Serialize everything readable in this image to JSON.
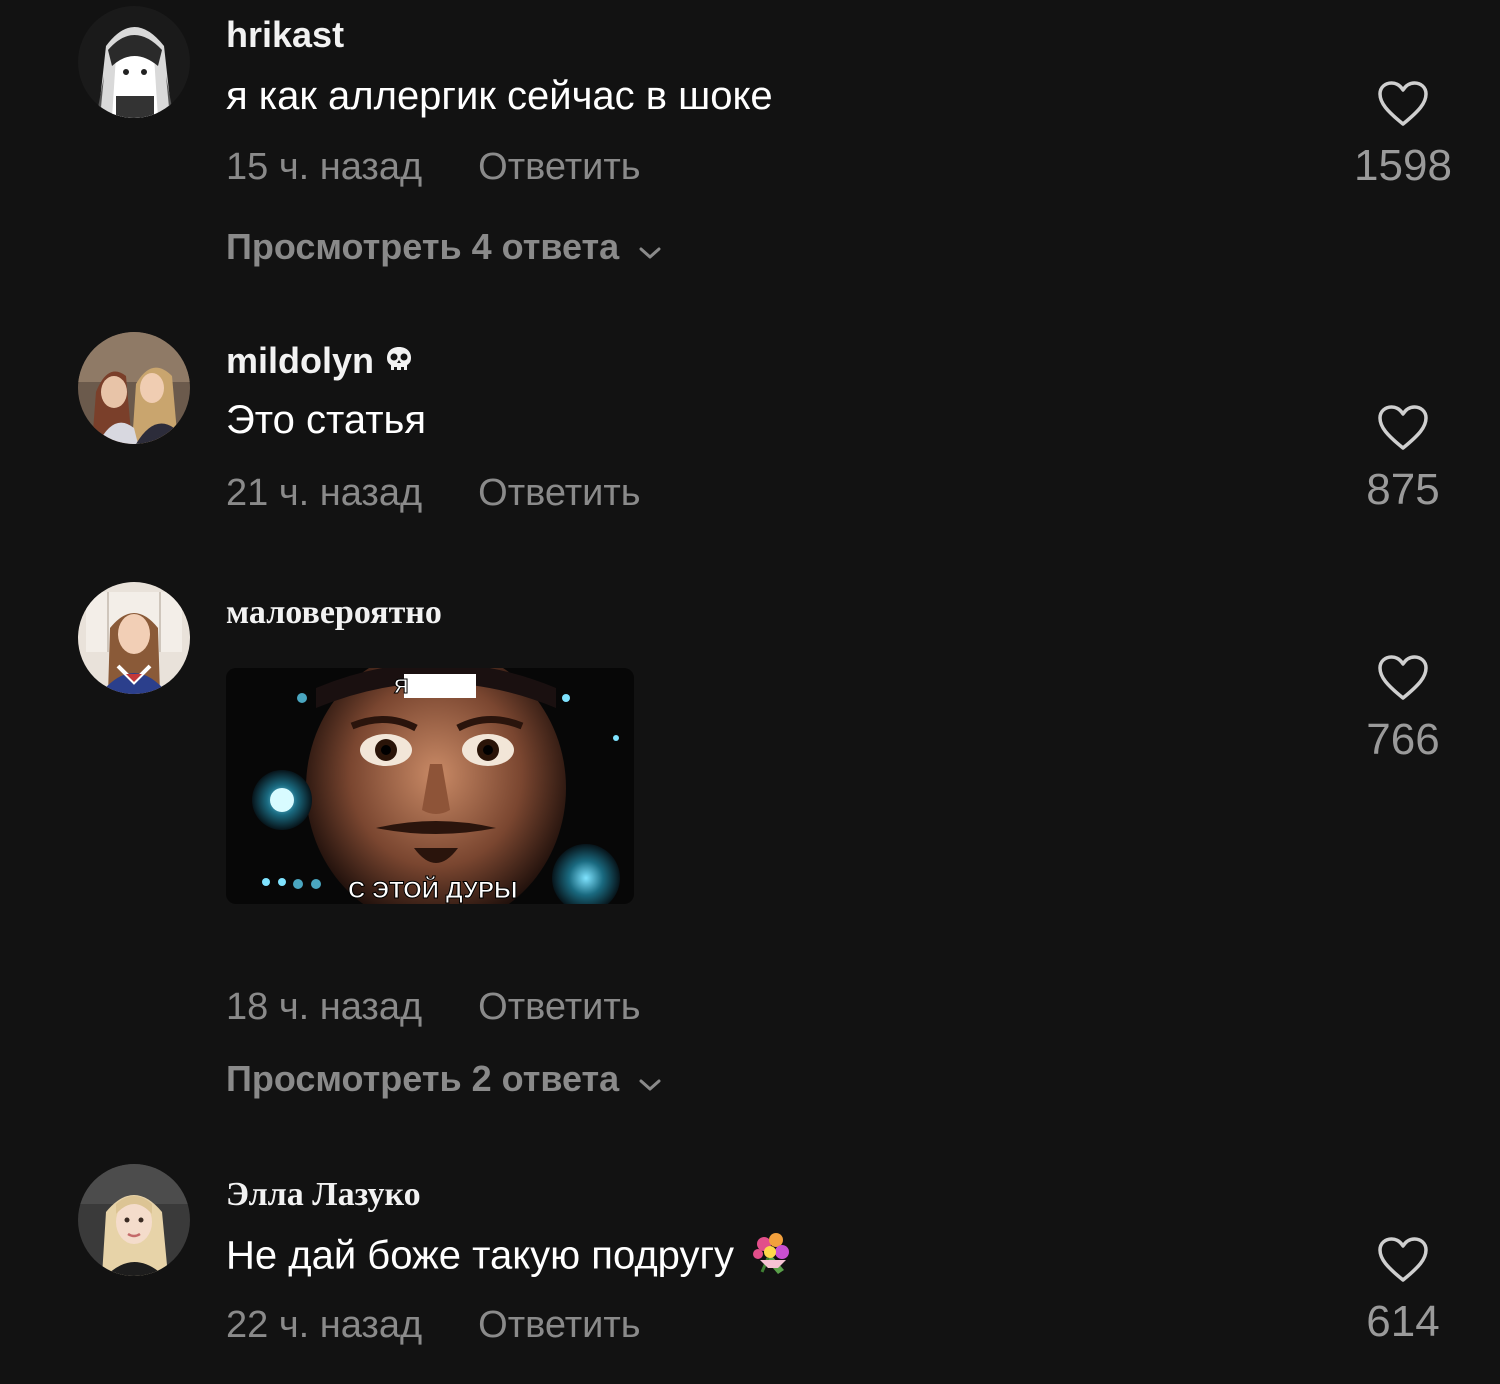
{
  "comments": [
    {
      "username": "hrikast",
      "text": "я как аллергик сейчас в шоке",
      "time": "15 ч. назад",
      "reply": "Ответить",
      "likes": "1598",
      "view_replies": "Просмотреть 4 ответа",
      "avatar_icon": "avatar-anime-girl"
    },
    {
      "username": "mildolyn",
      "badge_icon": "skull-icon",
      "text": "Это статья",
      "time": "21 ч. назад",
      "reply": "Ответить",
      "likes": "875",
      "avatar_icon": "avatar-two-women"
    },
    {
      "username": "маловероятно",
      "meme_top_text": "Я",
      "meme_bottom_text": "С ЭТОЙ ДУРЫ",
      "time": "18 ч. назад",
      "reply": "Ответить",
      "likes": "766",
      "view_replies": "Просмотреть 2 ответа",
      "avatar_icon": "avatar-woman-sailor"
    },
    {
      "username": "Элла Лазуко",
      "text": "Не дай боже такую подругу",
      "emoji_icon": "bouquet-icon",
      "time": "22 ч. назад",
      "reply": "Ответить",
      "likes": "614",
      "avatar_icon": "avatar-blonde-woman"
    }
  ],
  "colors": {
    "background": "#121212",
    "text_primary": "#ffffff",
    "text_secondary": "#8a8a8a",
    "like_count": "#9a9a9a"
  }
}
